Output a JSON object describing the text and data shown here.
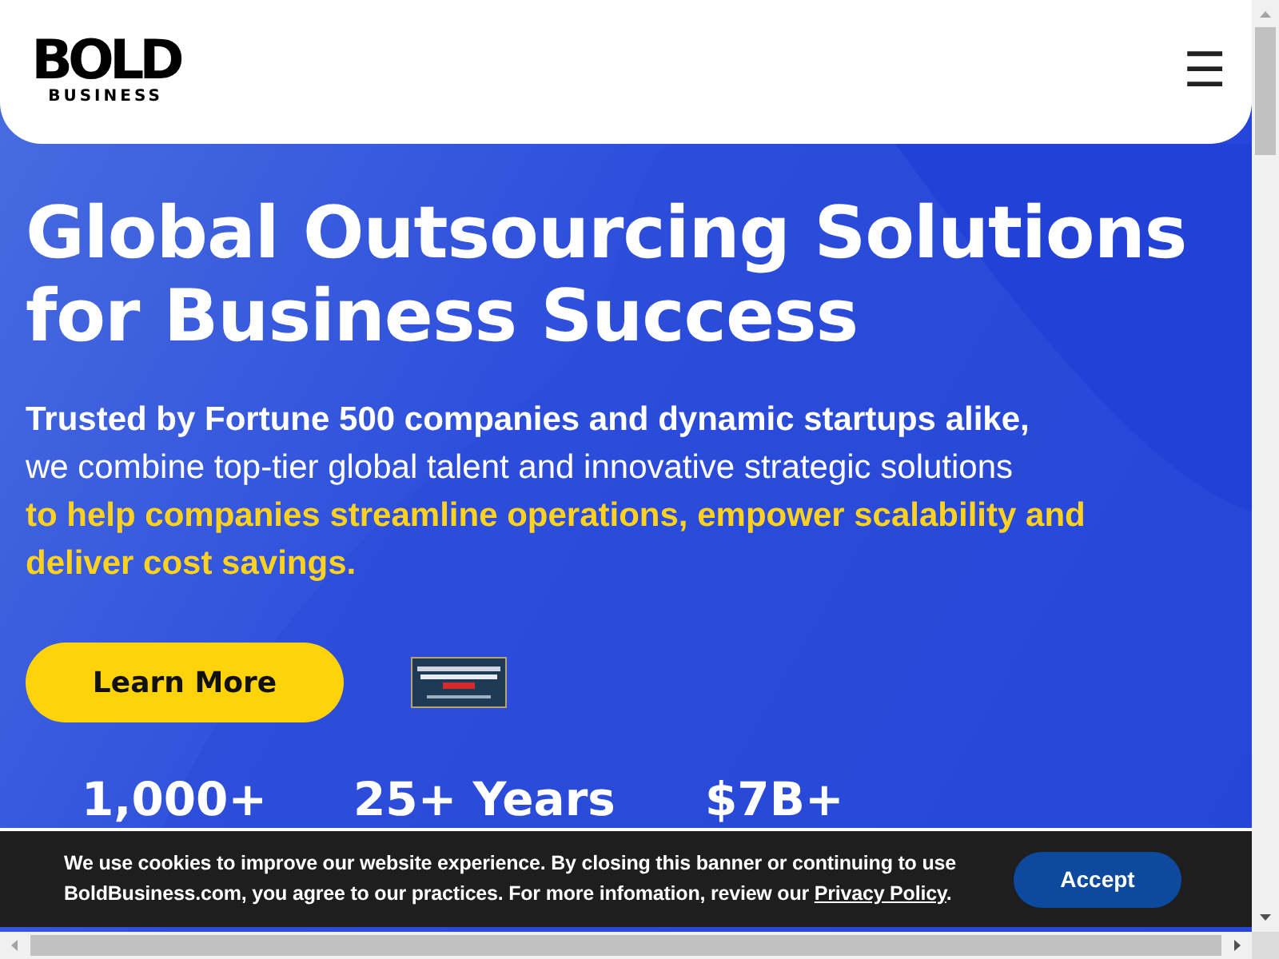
{
  "header": {
    "logo": {
      "word": "BOLD",
      "sub": "BUSINESS"
    },
    "menu_button": "☰"
  },
  "hero": {
    "title": "Global Outsourcing Solutions for Business Success",
    "subtitle": [
      {
        "text": "Trusted by Fortune 500 companies and dynamic startups alike,",
        "kind": "strong"
      },
      {
        "text": "we combine top-tier global talent and innovative strategic solutions",
        "kind": "plain"
      },
      {
        "text": "to help companies streamline operations, empower scalability and deliver cost savings.",
        "kind": "highlight"
      }
    ],
    "cta": "Learn More",
    "stats": [
      "1,000+",
      "25+ Years",
      "$7B+"
    ]
  },
  "cookie_banner": {
    "text": "We use cookies to improve our website experience. By closing this banner or continuing to use BoldBusiness.com, you agree to our practices. For more infomation, review our ",
    "link": "Privacy Policy",
    "end": ".",
    "button": "Accept"
  }
}
